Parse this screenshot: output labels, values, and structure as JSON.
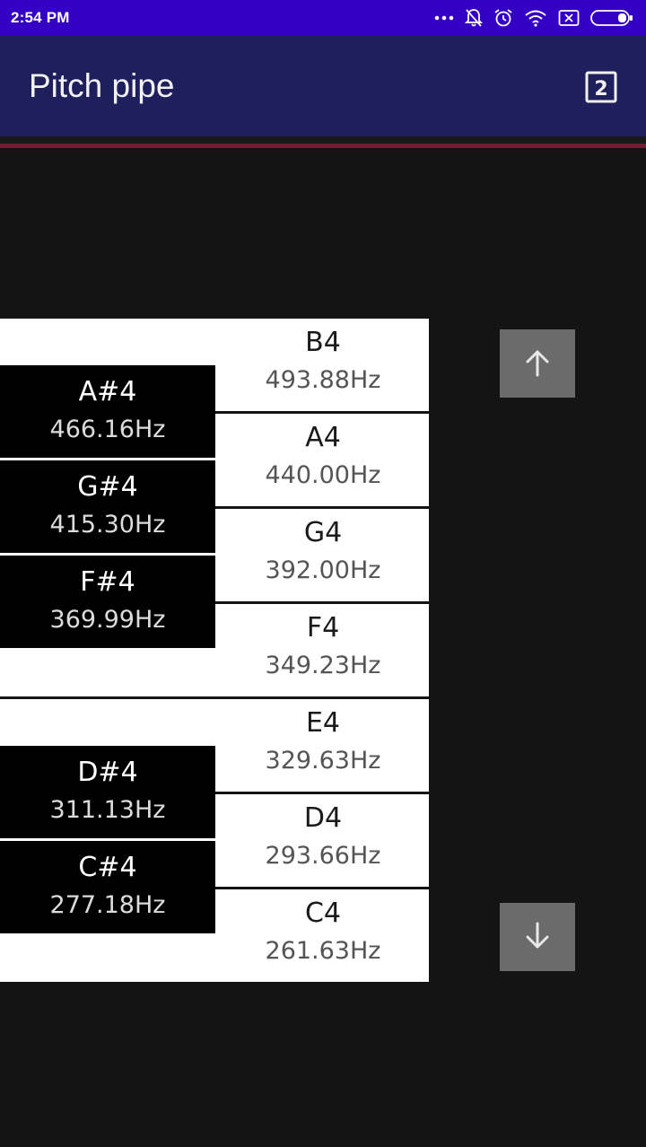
{
  "status_bar": {
    "time": "2:54 PM",
    "icons": [
      "more-dots-icon",
      "notifications-off-icon",
      "alarm-icon",
      "wifi-icon",
      "sim-x-icon",
      "battery-icon"
    ]
  },
  "app_bar": {
    "title": "Pitch pipe",
    "action_label": "2",
    "action_icon": "looks-two-icon"
  },
  "colors": {
    "status_bar": "#3500c6",
    "app_bar": "#1f1f5e",
    "accent_line": "#6e1f35",
    "background": "#141414",
    "button": "#6b6b6b"
  },
  "keyboard": {
    "white_keys": [
      {
        "note": "B4",
        "freq": "493.88Hz"
      },
      {
        "note": "A4",
        "freq": "440.00Hz"
      },
      {
        "note": "G4",
        "freq": "392.00Hz"
      },
      {
        "note": "F4",
        "freq": "349.23Hz"
      },
      {
        "note": "E4",
        "freq": "329.63Hz"
      },
      {
        "note": "D4",
        "freq": "293.66Hz"
      },
      {
        "note": "C4",
        "freq": "261.63Hz"
      }
    ],
    "black_keys": [
      {
        "note": "A#4",
        "freq": "466.16Hz"
      },
      {
        "note": "G#4",
        "freq": "415.30Hz"
      },
      {
        "note": "F#4",
        "freq": "369.99Hz"
      },
      {
        "note": "D#4",
        "freq": "311.13Hz"
      },
      {
        "note": "C#4",
        "freq": "277.18Hz"
      }
    ]
  },
  "controls": {
    "up_icon": "arrow-up-icon",
    "down_icon": "arrow-down-icon"
  }
}
